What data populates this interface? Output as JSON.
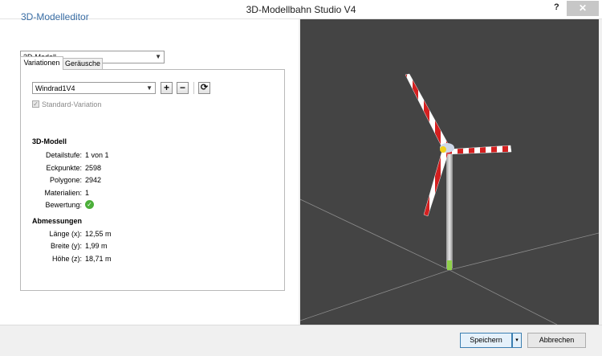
{
  "window": {
    "title": "3D-Modellbahn Studio V4",
    "help_label": "?",
    "close_label": "✕"
  },
  "editor": {
    "title": "3D-Modelleditor",
    "mode_select": "3D-Modell",
    "tabs": [
      {
        "label": "Variationen",
        "active": true
      },
      {
        "label": "Geräusche",
        "active": false
      }
    ],
    "variation_select": "Windrad1V4",
    "add_label": "+",
    "remove_label": "−",
    "refresh_label": "⟳",
    "standard_variation": {
      "label": "Standard-Variation",
      "checked": true
    },
    "model_heading": "3D-Modell",
    "model_props": [
      {
        "label": "Detailstufe:",
        "value": "1 von 1"
      },
      {
        "label": "Eckpunkte:",
        "value": "2598"
      },
      {
        "label": "Polygone:",
        "value": "2942"
      },
      {
        "label": "Materialien:",
        "value": "1"
      },
      {
        "label": "Bewertung:",
        "value": ""
      }
    ],
    "dims_heading": "Abmessungen",
    "dims": [
      {
        "label": "Länge (x):",
        "value": "12,55 m"
      },
      {
        "label": "Breite (y):",
        "value": "1,99 m"
      },
      {
        "label": "Höhe (z):",
        "value": "18,71 m"
      }
    ]
  },
  "buttons": {
    "save": "Speichern",
    "save_menu": "▾",
    "cancel": "Abbrechen"
  },
  "colors": {
    "accent": "#3a6ea5",
    "viewport_bg": "#444444",
    "blade_red": "#d42020",
    "rating_ok": "#4caf3a"
  },
  "icons": {
    "rating": "check-circle-icon"
  }
}
